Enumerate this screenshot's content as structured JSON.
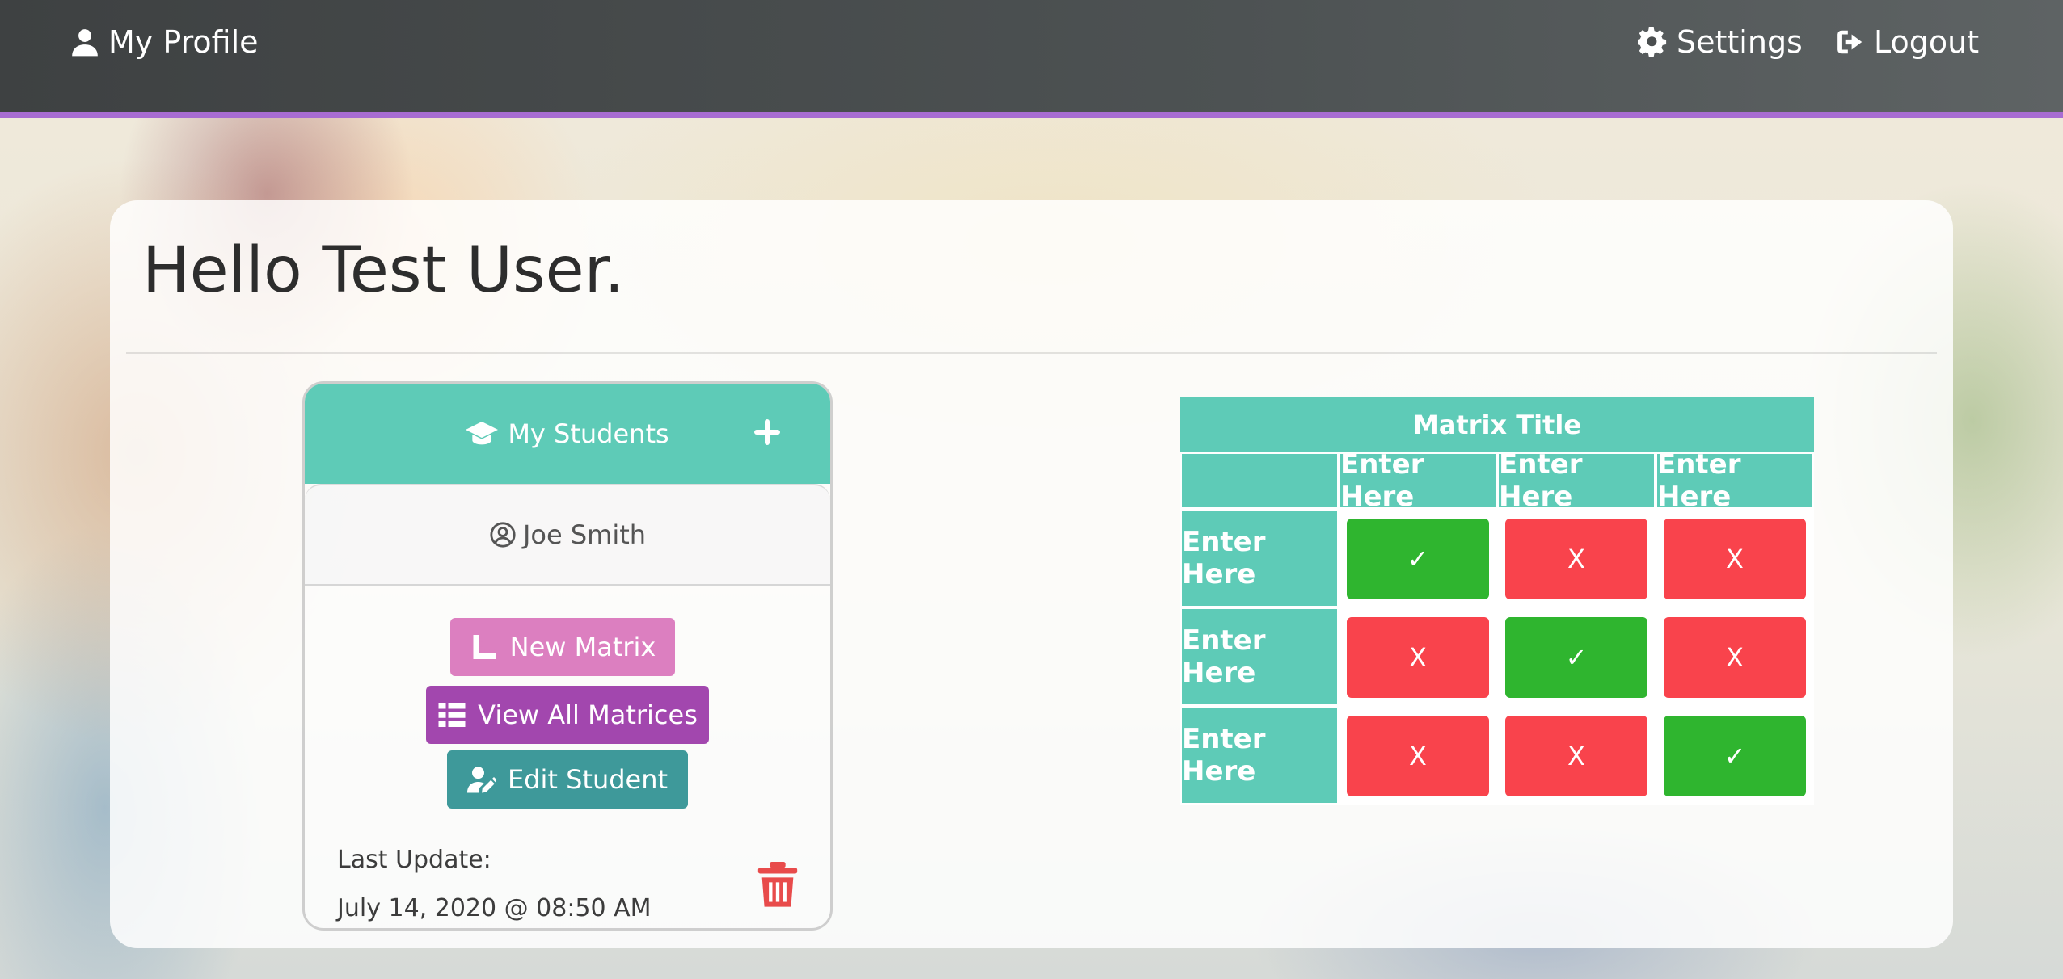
{
  "nav": {
    "profile_label": "My Profile",
    "settings_label": "Settings",
    "logout_label": "Logout"
  },
  "page": {
    "greeting": "Hello Test User."
  },
  "students": {
    "header_label": "My Students",
    "selected_student": "Joe Smith",
    "actions": {
      "new_matrix": "New Matrix",
      "view_all": "View All Matrices",
      "edit_student": "Edit Student"
    },
    "last_update_label": "Last Update:",
    "last_update_value": "July 14, 2020 @ 08:50 AM"
  },
  "matrix": {
    "title": "Matrix Title",
    "columns": [
      "Enter Here",
      "Enter Here",
      "Enter Here"
    ],
    "rows": [
      {
        "label": "Enter Here",
        "cells": [
          "✓",
          "X",
          "X"
        ]
      },
      {
        "label": "Enter Here",
        "cells": [
          "X",
          "✓",
          "X"
        ]
      },
      {
        "label": "Enter Here",
        "cells": [
          "X",
          "X",
          "✓"
        ]
      }
    ]
  },
  "colors": {
    "teal": "#5ecbb7",
    "pass_green": "#2fb52f",
    "fail_red": "#f9434c",
    "nav_accent": "#a86cd2"
  }
}
